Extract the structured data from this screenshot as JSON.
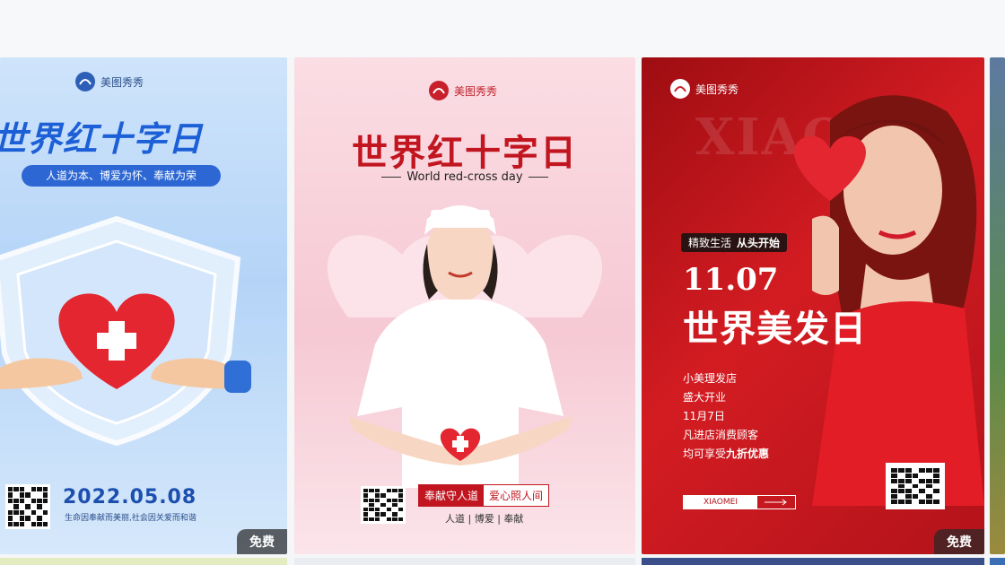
{
  "cards": [
    {
      "brand": "美图秀秀",
      "title": "世界红十字日",
      "slogan": "人道为本、博爱为怀、奉献为荣",
      "date": "2022.05.08",
      "footer": "生命因奉献而美丽,社会因关爱而和谐",
      "badge": "免费",
      "illustration": "heart-shield-hands"
    },
    {
      "brand": "美图秀秀",
      "title": "世界红十字日",
      "subtitle": "World red-cross day",
      "tag_left": "奉献守人道",
      "tag_right": "爱心照人间",
      "footer": "人道 | 博爱 | 奉献",
      "illustration": "nurse-heart"
    },
    {
      "brand": "美图秀秀",
      "bg_word": "XIAO",
      "pill_a": "精致生活",
      "pill_b": "从头开始",
      "date": "11.07",
      "title": "世界美发日",
      "info": [
        "小美理发店",
        "盛大开业",
        "11月7日",
        "凡进店消费顾客"
      ],
      "promo_prefix": "均可享受",
      "promo_bold": "九折优惠",
      "button_label": "XIAOMEI",
      "badge": "免费",
      "illustration": "woman-heart"
    }
  ],
  "colors": {
    "brand_red": "#d4202b",
    "blue_title": "#1c5fd6",
    "pink_bg": "#f6c9d4"
  }
}
